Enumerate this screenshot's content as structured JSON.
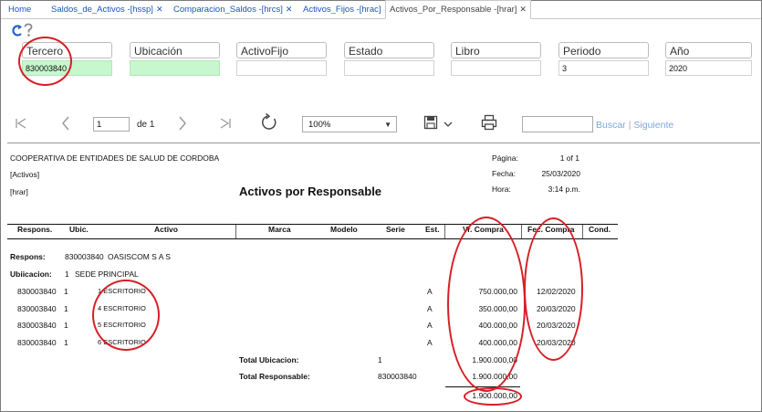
{
  "tabs": [
    {
      "label": "Home",
      "closable": false
    },
    {
      "label": "Saldos_de_Activos -[hssp]",
      "closable": true
    },
    {
      "label": "Comparacion_Saldos -[hrcs]",
      "closable": true
    },
    {
      "label": "Activos_Fijos -[hrac]",
      "closable": true
    },
    {
      "label": "Activos_Por_Responsable -[hrar]",
      "closable": true,
      "active": true
    }
  ],
  "close_glyph": "✕",
  "filters": [
    {
      "label": "Tercero",
      "value": "830003840"
    },
    {
      "label": "Ubicación",
      "value": ""
    },
    {
      "label": "ActivoFijo",
      "value": ""
    },
    {
      "label": "Estado",
      "value": ""
    },
    {
      "label": "Libro",
      "value": ""
    },
    {
      "label": "Periodo",
      "value": "3"
    },
    {
      "label": "Año",
      "value": "2020"
    }
  ],
  "toolbar": {
    "page_value": "1",
    "page_of": "de 1",
    "zoom": "100%",
    "search_value": "",
    "find_label": "Buscar",
    "find_sep": "|",
    "next_label": "Siguiente"
  },
  "report": {
    "company": "COOPERATIVA DE ENTIDADES DE SALUD DE CORDOBA",
    "module": "[Activos]",
    "code": "[hrar]",
    "title": "Activos por Responsable",
    "meta": [
      {
        "label": "Página:",
        "value": "1 of 1"
      },
      {
        "label": "Fecha:",
        "value": "25/03/2020"
      },
      {
        "label": "Hora:",
        "value": "3:14 p.m."
      }
    ],
    "columns": [
      "Respons.",
      "Ubic.",
      "Activo",
      "Marca",
      "Modelo",
      "Serie",
      "Est.",
      "Vr. Compra",
      "Fec. Compra",
      "Cond."
    ],
    "responsable_label": "Respons:",
    "responsable_code": "830003840",
    "responsable_name": "OASISCOM S A S",
    "ubicacion_label": "Ubiicacion:",
    "ubicacion_code": "1",
    "ubicacion_name": "SEDE PRINCIPAL",
    "rows": [
      {
        "respons": "830003840",
        "ubic": "1",
        "activo": "1 ESCRITORIO",
        "est": "A",
        "vr": "750.000,00",
        "fec": "12/02/2020"
      },
      {
        "respons": "830003840",
        "ubic": "1",
        "activo": "4 ESCRITORIO",
        "est": "A",
        "vr": "350.000,00",
        "fec": "20/03/2020"
      },
      {
        "respons": "830003840",
        "ubic": "1",
        "activo": "5 ESCRITORIO",
        "est": "A",
        "vr": "400.000,00",
        "fec": "20/03/2020"
      },
      {
        "respons": "830003840",
        "ubic": "1",
        "activo": "6 ESCRITORIO",
        "est": "A",
        "vr": "400.000,00",
        "fec": "20/03/2020"
      }
    ],
    "total_ubicacion_label": "Total Ubicacion:",
    "total_ubicacion_ref": "1",
    "total_ubicacion_value": "1.900.000,00",
    "total_responsable_label": "Total Responsable:",
    "total_responsable_ref": "830003840",
    "total_responsable_value": "1.900.000,00",
    "grand_total": "1.900.000,00"
  },
  "colors": {
    "link": "#1a55b8",
    "highlight_field": "#c6f7cd",
    "annotation": "#d61f26"
  }
}
